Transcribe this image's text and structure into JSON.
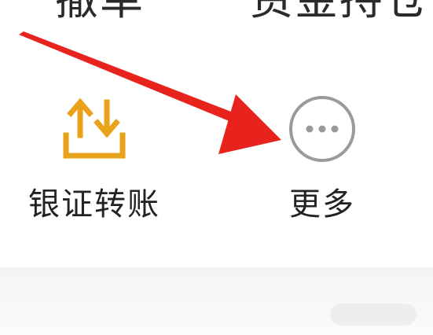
{
  "top_row": {
    "left_label": "撤单",
    "right_label": "资金持仓"
  },
  "tiles": {
    "bank_transfer": {
      "label": "银证转账",
      "icon": "transfer-arrows-icon",
      "icon_color": "#E9A21A"
    },
    "more": {
      "label": "更多",
      "icon": "more-dots-icon",
      "icon_color": "#9A9A9A"
    }
  },
  "annotation": {
    "arrow_color": "#E8231E"
  }
}
